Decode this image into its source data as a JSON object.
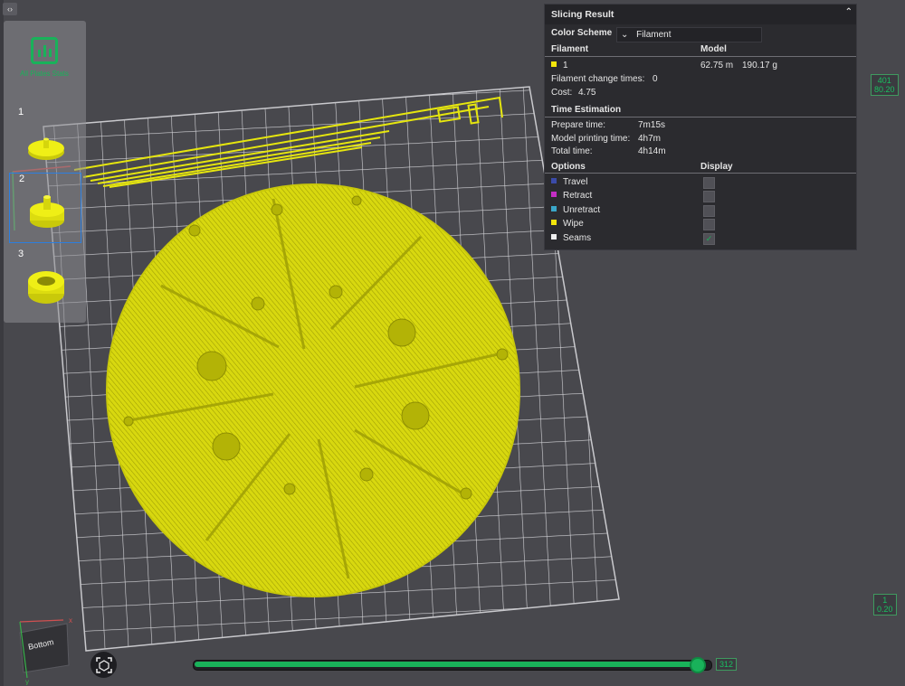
{
  "plates": {
    "all_stats_label": "All Plates Stats",
    "items": [
      {
        "number": "1"
      },
      {
        "number": "2"
      },
      {
        "number": "3"
      }
    ]
  },
  "slicing_result": {
    "title": "Slicing Result",
    "color_scheme_label": "Color Scheme",
    "color_scheme_value": "Filament",
    "filament_header": "Filament",
    "model_header": "Model",
    "filament_id": "1",
    "filament_color": "#f3e60b",
    "filament_length": "62.75 m",
    "filament_weight": "190.17 g",
    "change_times_label": "Filament change times:",
    "change_times_value": "0",
    "cost_label": "Cost:",
    "cost_value": "4.75",
    "time_header": "Time Estimation",
    "prepare_label": "Prepare time:",
    "prepare_value": "7m15s",
    "printing_label": "Model printing time:",
    "printing_value": "4h7m",
    "total_label": "Total time:",
    "total_value": "4h14m",
    "options_header": "Options",
    "display_header": "Display",
    "options": [
      {
        "label": "Travel",
        "color": "#3b4ba8",
        "checked": false
      },
      {
        "label": "Retract",
        "color": "#c42ec4",
        "checked": false
      },
      {
        "label": "Unretract",
        "color": "#3aa6c8",
        "checked": false
      },
      {
        "label": "Wipe",
        "color": "#f2e40c",
        "checked": false
      },
      {
        "label": "Seams",
        "color": "#efefef",
        "checked": true
      }
    ]
  },
  "vertical_slider": {
    "top_layer": "401",
    "top_height": "80.20",
    "bottom_layer": "1",
    "bottom_height": "0.20"
  },
  "horizontal_slider": {
    "value": "312",
    "fraction": 0.975
  },
  "view_cube": {
    "face_label": "Bottom",
    "x_label": "x",
    "y_label": "y"
  },
  "colors": {
    "accent": "#19b25a",
    "print": "#dfdf10",
    "background": "#48484d"
  }
}
